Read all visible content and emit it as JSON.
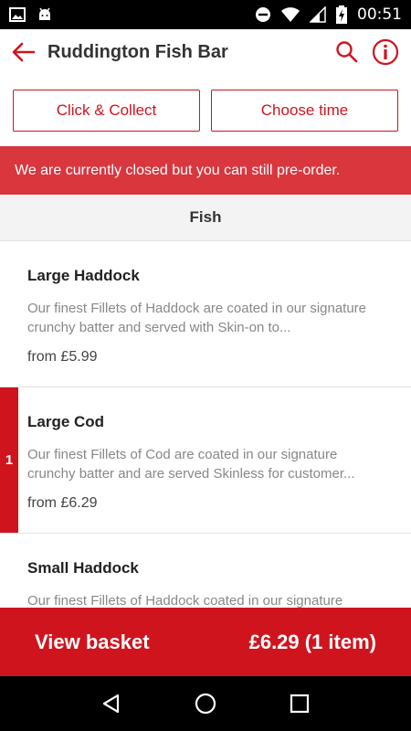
{
  "status_bar": {
    "time": "00:51"
  },
  "header": {
    "title": "Ruddington Fish Bar"
  },
  "order_modes": {
    "collect_label": "Click & Collect",
    "time_label": "Choose time"
  },
  "banner": {
    "text": "We are currently closed but you can still pre-order."
  },
  "category": {
    "title": "Fish"
  },
  "items": [
    {
      "name": "Large Haddock",
      "description": "Our finest Fillets of Haddock are coated in our signature crunchy batter and served with Skin-on to...",
      "price": "from £5.99",
      "quantity": ""
    },
    {
      "name": "Large Cod",
      "description": "Our finest Fillets of Cod are coated in our signature crunchy batter and are served Skinless for customer...",
      "price": "from £6.29",
      "quantity": "1"
    },
    {
      "name": "Small Haddock",
      "description": "Our finest Fillets of Haddock coated in our signature",
      "price": "",
      "quantity": ""
    }
  ],
  "basket": {
    "label": "View basket",
    "total": "£6.29 (1 item)"
  },
  "colors": {
    "brand_red": "#d0141e",
    "banner_red": "#d9363e"
  },
  "icons": [
    "image-icon",
    "android-icon",
    "do-not-disturb-icon",
    "wifi-icon",
    "signal-icon",
    "battery-charging-icon",
    "back-arrow-icon",
    "search-icon",
    "info-icon",
    "nav-back-icon",
    "nav-home-icon",
    "nav-recents-icon"
  ]
}
